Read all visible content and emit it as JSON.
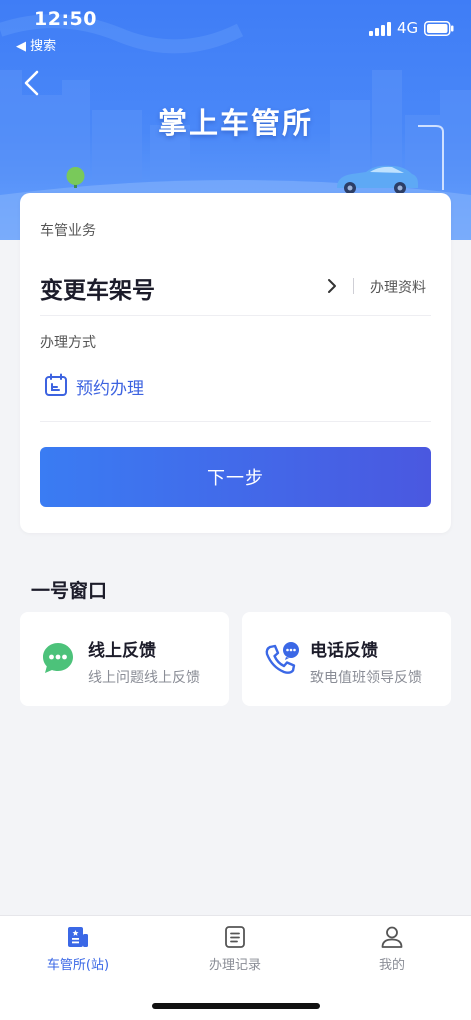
{
  "status_bar": {
    "time": "12:50",
    "back_app": "◀ 搜索",
    "network": "4G"
  },
  "header": {
    "title": "掌上车管所"
  },
  "card": {
    "business_label": "车管业务",
    "business_name": "变更车架号",
    "materials_link": "办理资料",
    "method_label": "办理方式",
    "method_value": "预约办理",
    "next_button": "下一步"
  },
  "window_section": {
    "title": "一号窗口",
    "items": [
      {
        "title": "线上反馈",
        "subtitle": "线上问题线上反馈",
        "icon": "chat-bubble-icon"
      },
      {
        "title": "电话反馈",
        "subtitle": "致电值班领导反馈",
        "icon": "phone-chat-icon"
      }
    ]
  },
  "tabbar": {
    "items": [
      {
        "label": "车管所(站)",
        "icon": "station-icon",
        "active": true
      },
      {
        "label": "办理记录",
        "icon": "record-icon",
        "active": false
      },
      {
        "label": "我的",
        "icon": "user-icon",
        "active": false
      }
    ]
  },
  "colors": {
    "primary": "#3b68e6",
    "green": "#4cc27a",
    "header_blue": "#3f7df6"
  }
}
